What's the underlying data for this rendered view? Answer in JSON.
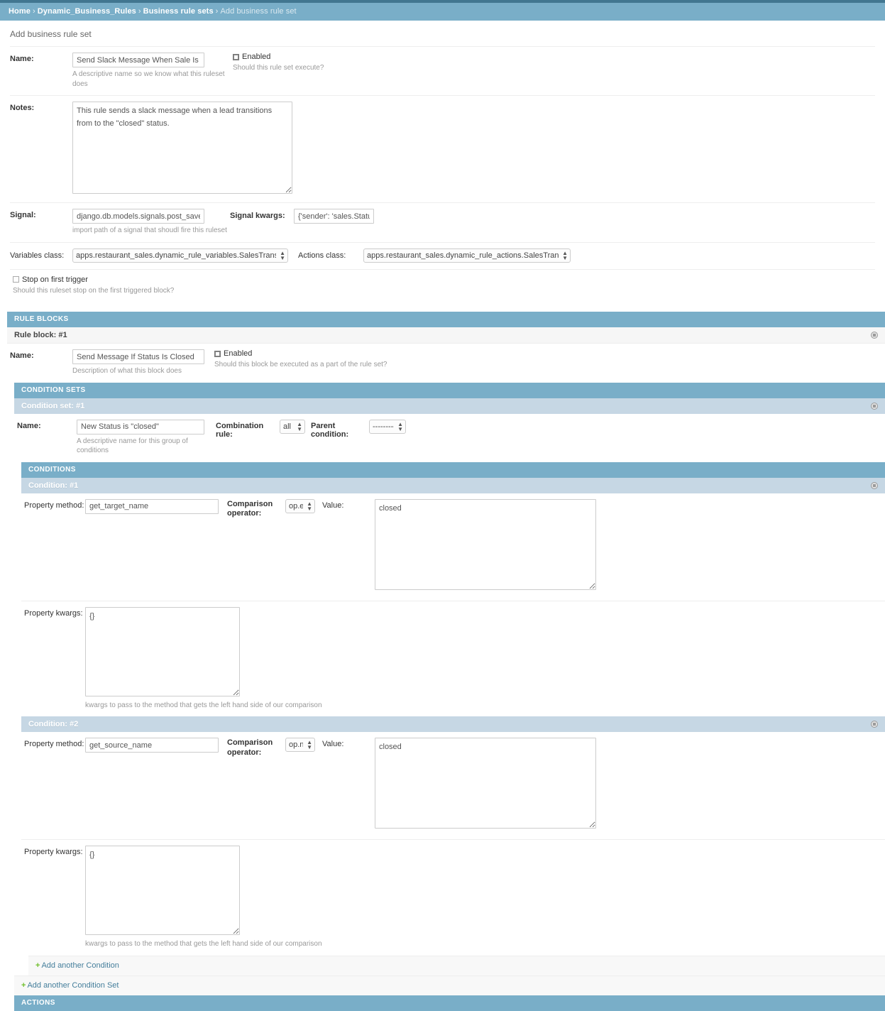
{
  "breadcrumbs": [
    {
      "label": "Home",
      "current": false
    },
    {
      "label": "Dynamic_Business_Rules",
      "current": false
    },
    {
      "label": "Business rule sets",
      "current": false
    },
    {
      "label": "Add business rule set",
      "current": true
    }
  ],
  "page_title": "Add business rule set",
  "colors": {
    "top_strip": "#417690",
    "breadcrumb_bar": "#79aec8",
    "module_header": "#79aec8",
    "subheader_blue": "#c6d7e4",
    "link": "#447e9b",
    "add_plus": "#70bf2b"
  },
  "ruleset": {
    "name_label": "Name:",
    "name_value": "Send Slack Message When Sale Is Closed",
    "name_help": "A descriptive name so we know what this ruleset does",
    "enabled_label": "Enabled",
    "enabled_checked": true,
    "enabled_help": "Should this rule set execute?",
    "notes_label": "Notes:",
    "notes_value": "This rule sends a slack message when a lead transitions from to the \"closed\" status.",
    "signal_label": "Signal:",
    "signal_value": "django.db.models.signals.post_save",
    "signal_help": "import path of a signal that shoudl fire this ruleset",
    "signal_kwargs_label": "Signal kwargs:",
    "signal_kwargs_value": "{'sender': 'sales.StatusTrai",
    "variables_class_label": "Variables class:",
    "variables_class_value": "apps.restaurant_sales.dynamic_rule_variables.SalesTransitionVariables",
    "actions_class_label": "Actions class:",
    "actions_class_value": "apps.restaurant_sales.dynamic_rule_actions.SalesTransitionActions",
    "stop_on_first_trigger_label": "Stop on first trigger",
    "stop_on_first_trigger_checked": false,
    "stop_on_first_trigger_help": "Should this ruleset stop on the first triggered block?"
  },
  "rule_blocks": {
    "section_title": "RULE BLOCKS",
    "block": {
      "header": "Rule block: #1",
      "name_label": "Name:",
      "name_value": "Send Message If Status Is Closed",
      "name_help": "Description of what this block does",
      "enabled_label": "Enabled",
      "enabled_checked": true,
      "enabled_help": "Should this block be executed as a part of the rule set?"
    },
    "condition_sets": {
      "section_title": "CONDITION SETS",
      "set": {
        "header": "Condition set: #1",
        "name_label": "Name:",
        "name_value": "New Status is \"closed\"",
        "name_help": "A descriptive name for this group of conditions",
        "combination_rule_label": "Combination rule:",
        "combination_rule_value": "all",
        "parent_condition_label": "Parent condition:",
        "parent_condition_value": "---------"
      },
      "conditions": {
        "section_title": "CONDITIONS",
        "labels": {
          "property_method": "Property method:",
          "comparison_operator": "Comparison operator:",
          "value": "Value:",
          "property_kwargs": "Property kwargs:",
          "property_kwargs_help": "kwargs to pass to the method that gets the left hand side of our comparison"
        },
        "items": [
          {
            "header": "Condition: #1",
            "property_method": "get_target_name",
            "comparison_operator": "op.eq",
            "value": "closed",
            "property_kwargs": "{}"
          },
          {
            "header": "Condition: #2",
            "property_method": "get_source_name",
            "comparison_operator": "op.ne",
            "value": "closed",
            "property_kwargs": "{}"
          }
        ]
      },
      "add_condition_label": "Add another Condition",
      "add_condition_set_label": "Add another Condition Set"
    }
  },
  "actions": {
    "section_title": "ACTIONS"
  }
}
